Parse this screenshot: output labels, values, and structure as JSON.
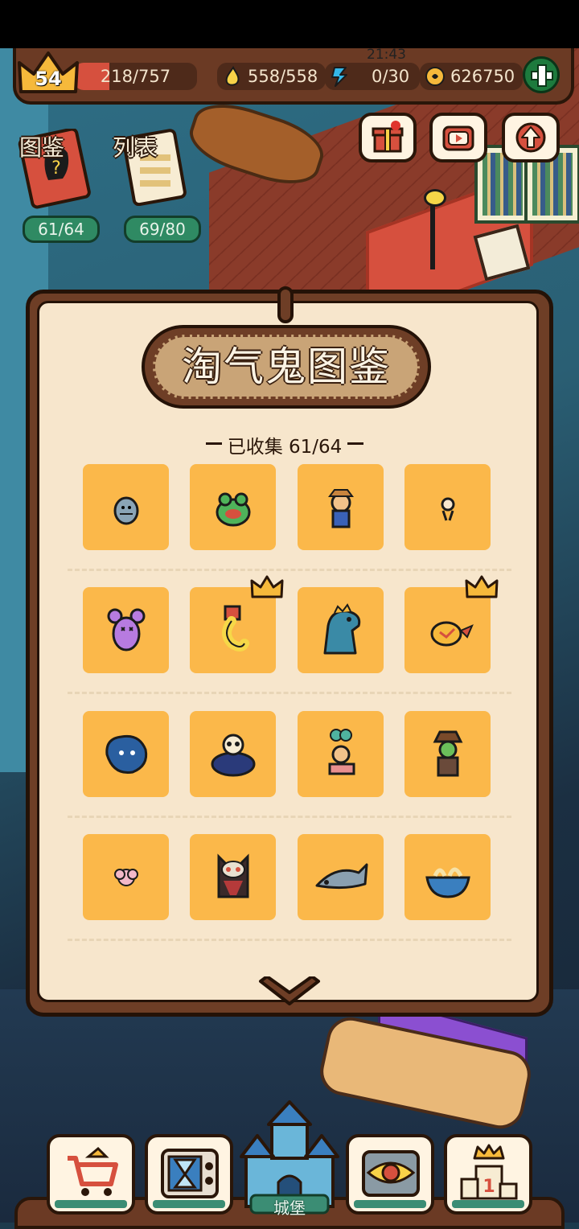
{
  "status_bar": {
    "time": "21:43"
  },
  "hud": {
    "level": "54",
    "xp_text": "218/757",
    "xp_progress": 0.288,
    "stamina_text": "558/558",
    "energy_text": "0/30",
    "coins_text": "626750"
  },
  "actions": {
    "gift_icon": "gift-icon",
    "video_icon": "video-icon",
    "upgrade_icon": "upgrade-arrow-icon"
  },
  "left_panel": {
    "book_label": "图鉴",
    "book_count": "61/64",
    "list_label": "列表",
    "list_count": "69/80"
  },
  "panel": {
    "title": "淘气鬼图鉴",
    "collected_text": "已收集 61/64",
    "rows": [
      [
        {
          "icon": "shark-ghost"
        },
        {
          "icon": "frog-ghost"
        },
        {
          "icon": "scarecrow-ghost"
        },
        {
          "icon": "tiny-sprite-ghost"
        }
      ],
      [
        {
          "icon": "purple-rat-ghost"
        },
        {
          "icon": "caterpillar-ghost",
          "crown": true
        },
        {
          "icon": "dinosaur-ghost"
        },
        {
          "icon": "bird-ghost",
          "crown": true
        }
      ],
      [
        {
          "icon": "blue-blob-ghost"
        },
        {
          "icon": "panda-ghost"
        },
        {
          "icon": "clover-girl-ghost"
        },
        {
          "icon": "detective-ghost"
        }
      ],
      [
        {
          "icon": "pink-puff-ghost"
        },
        {
          "icon": "owl-ghost"
        },
        {
          "icon": "fish-ghost"
        },
        {
          "icon": "noodle-bowl-ghost"
        }
      ]
    ]
  },
  "bottom_nav": {
    "items": [
      {
        "icon": "shop-cart-icon"
      },
      {
        "icon": "hourglass-tv-icon"
      },
      {
        "icon": "castle-icon",
        "label": "城堡"
      },
      {
        "icon": "eye-tv-icon"
      },
      {
        "icon": "ranking-podium-icon"
      }
    ]
  },
  "colors": {
    "panel_brown": "#6e3e26",
    "cell_orange": "#fbb84a",
    "paper": "#f7e6cc",
    "green_pill": "#2f8a63"
  }
}
